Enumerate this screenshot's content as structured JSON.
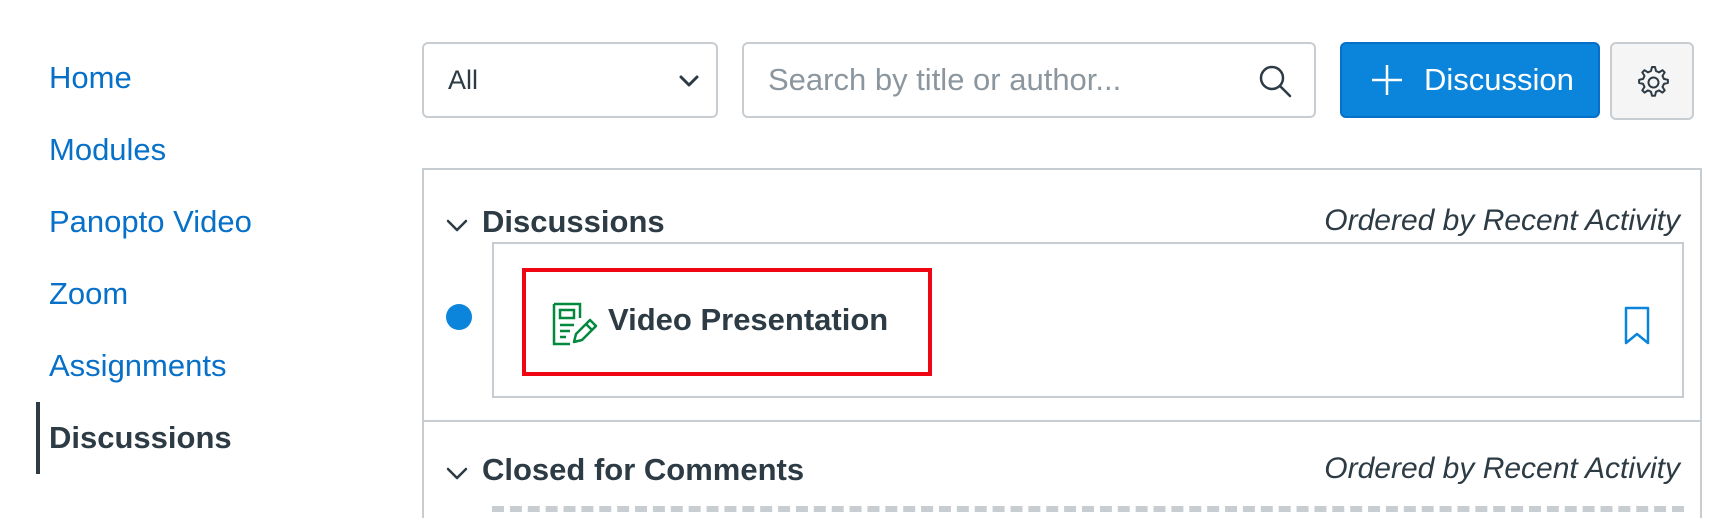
{
  "sidebar": {
    "items": [
      {
        "label": "Home"
      },
      {
        "label": "Modules"
      },
      {
        "label": "Panopto Video"
      },
      {
        "label": "Zoom"
      },
      {
        "label": "Assignments"
      },
      {
        "label": "Discussions",
        "active": true
      }
    ]
  },
  "toolbar": {
    "filter": {
      "selected": "All",
      "icon": "chevron-down-icon"
    },
    "search": {
      "placeholder": "Search by title or author...",
      "value": "",
      "icon": "search-icon"
    },
    "add_button": {
      "label": "Discussion",
      "icon": "plus-icon"
    },
    "settings_button": {
      "icon": "gear-icon"
    }
  },
  "sections": [
    {
      "title": "Discussions",
      "order_label": "Ordered by Recent Activity",
      "items": [
        {
          "title": "Video Presentation",
          "unread": true,
          "icon": "discussion-edit-icon",
          "bookmark_icon": "bookmark-icon"
        }
      ]
    },
    {
      "title": "Closed for Comments",
      "order_label": "Ordered by Recent Activity",
      "items": []
    }
  ],
  "colors": {
    "link": "#0770c8",
    "primary_button": "#0b84db",
    "text": "#2d3b45",
    "border": "#c7cdd1",
    "highlight": "#ee0612",
    "published_icon": "#03893d"
  }
}
